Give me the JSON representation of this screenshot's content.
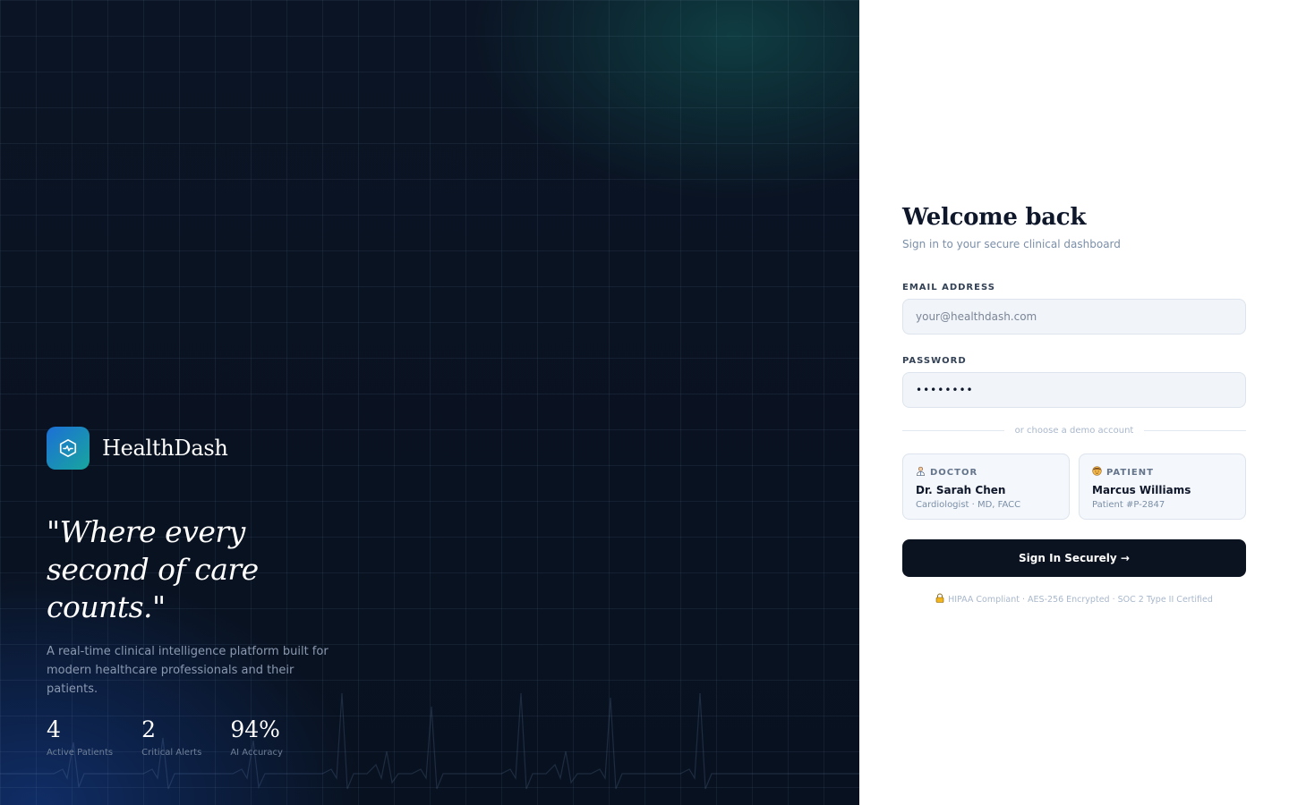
{
  "brand": {
    "name": "HealthDash",
    "logo_icon": "heartbeat-hexagon-icon"
  },
  "hero": {
    "quote": "\"Where every second of care counts.\"",
    "tagline": "A real-time clinical intelligence platform built for modern healthcare professionals and their patients.",
    "stats": [
      {
        "value": "4",
        "label": "Active Patients"
      },
      {
        "value": "2",
        "label": "Critical Alerts"
      },
      {
        "value": "94%",
        "label": "AI Accuracy"
      }
    ]
  },
  "login": {
    "title": "Welcome back",
    "subtitle": "Sign in to your secure clinical dashboard",
    "email_label": "EMAIL ADDRESS",
    "email_placeholder": "your@healthdash.com",
    "email_value": "",
    "password_label": "PASSWORD",
    "password_value": "••••••••",
    "divider_text": "or choose a demo account",
    "demo_accounts": [
      {
        "role": "DOCTOR",
        "icon": "doctor-icon",
        "name": "Dr. Sarah Chen",
        "detail": "Cardiologist · MD, FACC"
      },
      {
        "role": "PATIENT",
        "icon": "patient-icon",
        "name": "Marcus Williams",
        "detail": "Patient #P-2847"
      }
    ],
    "submit_label": "Sign In Securely →",
    "compliance_icon": "lock-icon",
    "compliance_text": "HIPAA Compliant · AES-256 Encrypted · SOC 2 Type II Certified"
  },
  "colors": {
    "hero_bg": "#0b1424",
    "accent_blue": "#1c6fd6",
    "accent_teal": "#18a69e",
    "button_bg": "#0b1220",
    "input_bg": "#f1f5f9"
  }
}
